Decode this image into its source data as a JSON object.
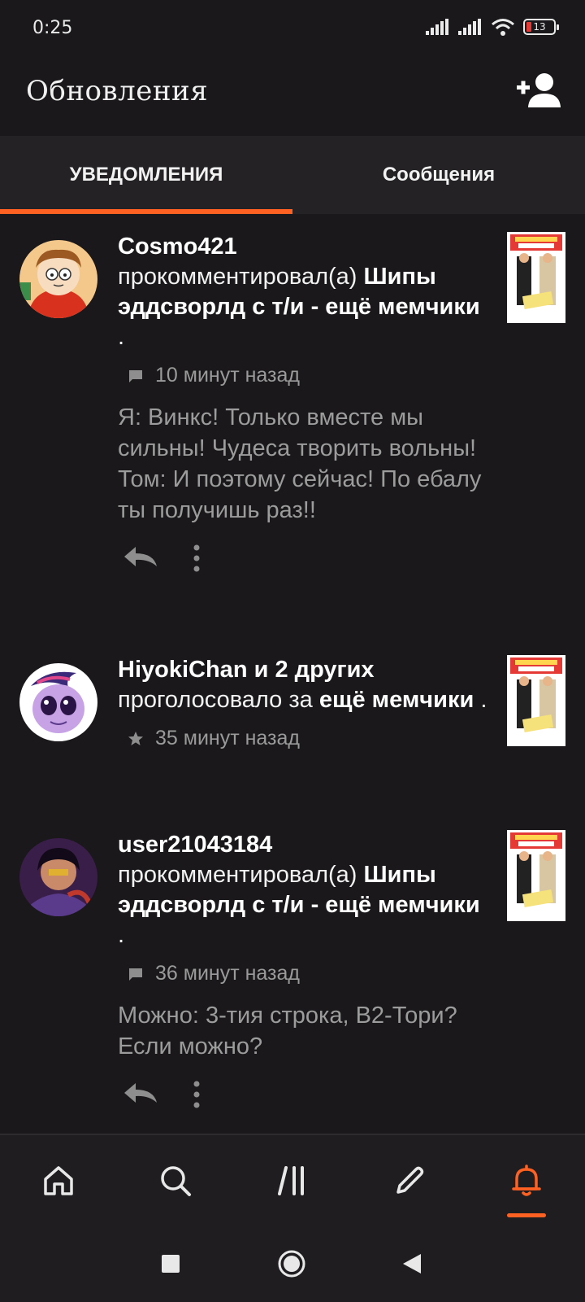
{
  "status_bar": {
    "time": "0:25",
    "battery_level": "13"
  },
  "header": {
    "title": "Обновления"
  },
  "tabs": [
    {
      "label": "УВЕДОМЛЕНИЯ",
      "active": true
    },
    {
      "label": "Сообщения",
      "active": false
    }
  ],
  "notifications": [
    {
      "username": "Cosmo421",
      "action": "прокомментировал(а)",
      "story": "Шипы эддсворлд с т/и - ещё мемчики",
      "suffix": " .",
      "meta_icon": "comment-icon",
      "time": "10 минут назад",
      "comment_line1": "Я: Винкс! Только вместе мы сильны! Чудеса творить вольны!",
      "comment_line2": "Том: И поэтому сейчас! По ебалу ты получишь раз!!"
    },
    {
      "username": "HiyokiChan и 2 других",
      "action": "проголосовало за",
      "story": "ещё мемчики",
      "suffix": " .",
      "meta_icon": "star-icon",
      "time": "35 минут назад"
    },
    {
      "username": "user21043184",
      "action": "прокомментировал(а)",
      "story": "Шипы эддсворлд с т/и - ещё мемчики",
      "suffix": " .",
      "meta_icon": "comment-icon",
      "time": "36 минут назад",
      "comment_line1": "Можно: 3-тия строка, В2-Тори? Если можно?"
    }
  ],
  "bottom_nav": [
    {
      "icon": "home-icon"
    },
    {
      "icon": "search-icon"
    },
    {
      "icon": "library-icon"
    },
    {
      "icon": "pencil-icon"
    },
    {
      "icon": "bell-icon",
      "active": true
    }
  ],
  "colors": {
    "accent": "#ff6122",
    "background": "#1a181b",
    "muted_text": "#9c9c9c"
  }
}
